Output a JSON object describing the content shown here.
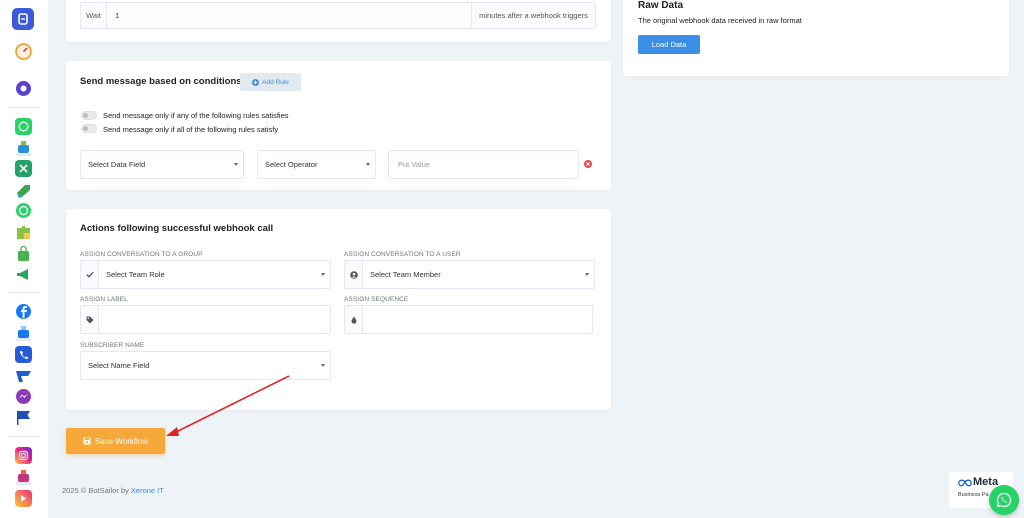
{
  "sidebar": {
    "icons": [
      {
        "name": "app-logo-icon",
        "color": "#3b5bdb"
      },
      {
        "name": "gauge-icon",
        "color": "#f7931e"
      },
      {
        "name": "chat-bubble-icon",
        "color": "#5c3fd4"
      },
      {
        "name": "whatsapp-square-icon",
        "color": "#25d366"
      },
      {
        "name": "robot-icon",
        "color": "#2b8fd9"
      },
      {
        "name": "spreadsheet-icon",
        "color": "#21a366"
      },
      {
        "name": "megaphone-tag-icon",
        "color": "#3fa34d"
      },
      {
        "name": "whatsapp-icon",
        "color": "#25d366"
      },
      {
        "name": "puzzle-icon",
        "color": "#8bc34a"
      },
      {
        "name": "shopping-bag-icon",
        "color": "#4caf50"
      },
      {
        "name": "bullhorn-icon",
        "color": "#26a65b"
      },
      {
        "name": "facebook-icon",
        "color": "#1877f2"
      },
      {
        "name": "messenger-bot-icon",
        "color": "#1877f2"
      },
      {
        "name": "phone-book-icon",
        "color": "#2a5bd7"
      },
      {
        "name": "broadcast-icon",
        "color": "#1b5fce"
      },
      {
        "name": "messenger-icon",
        "color": "#8a3ab9"
      },
      {
        "name": "flag-icon",
        "color": "#1e4fb8"
      },
      {
        "name": "instagram-icon",
        "color": "#e1306c"
      },
      {
        "name": "instagram-bot-icon",
        "color": "#c13584"
      },
      {
        "name": "instagram-post-icon",
        "color": "#f56040"
      }
    ]
  },
  "wait": {
    "label": "Wait",
    "value": "1",
    "suffix": "minutes after a webhook triggers"
  },
  "conditions": {
    "title": "Send message based on conditions",
    "add_rule": "Add Rule",
    "option_any": "Send message only if any of the following rules satisfies",
    "option_all": "Send message only if all of the following rules satisfy",
    "data_field": "Select Data Field",
    "operator": "Select Operator",
    "value_placeholder": "Put Value"
  },
  "actions": {
    "title": "Actions following successful webhook call",
    "group_label": "ASSIGN CONVERSATION TO A GROUP",
    "group_value": "Select Team Role",
    "user_label": "ASSIGN CONVERSATION TO A USER",
    "user_value": "Select Team Member",
    "label_label": "ASSIGN LABEL",
    "sequence_label": "ASSIGN SEQUENCE",
    "subscriber_label": "SUBSCRIBER NAME",
    "subscriber_value": "Select Name Field"
  },
  "save": {
    "label": "Save Workflow"
  },
  "raw": {
    "title": "Raw Data",
    "desc": "The original webhook data received in raw format",
    "button": "Load Data"
  },
  "footer": {
    "prefix": "2025 © BotSailor by ",
    "company": "Xerone IT"
  },
  "meta": {
    "logo": "Meta",
    "sub": "Business Pa"
  },
  "colors": {
    "primary": "#3a8ee6",
    "save": "#f6a83a",
    "arrow": "#e02424",
    "whatsapp": "#25d366"
  }
}
